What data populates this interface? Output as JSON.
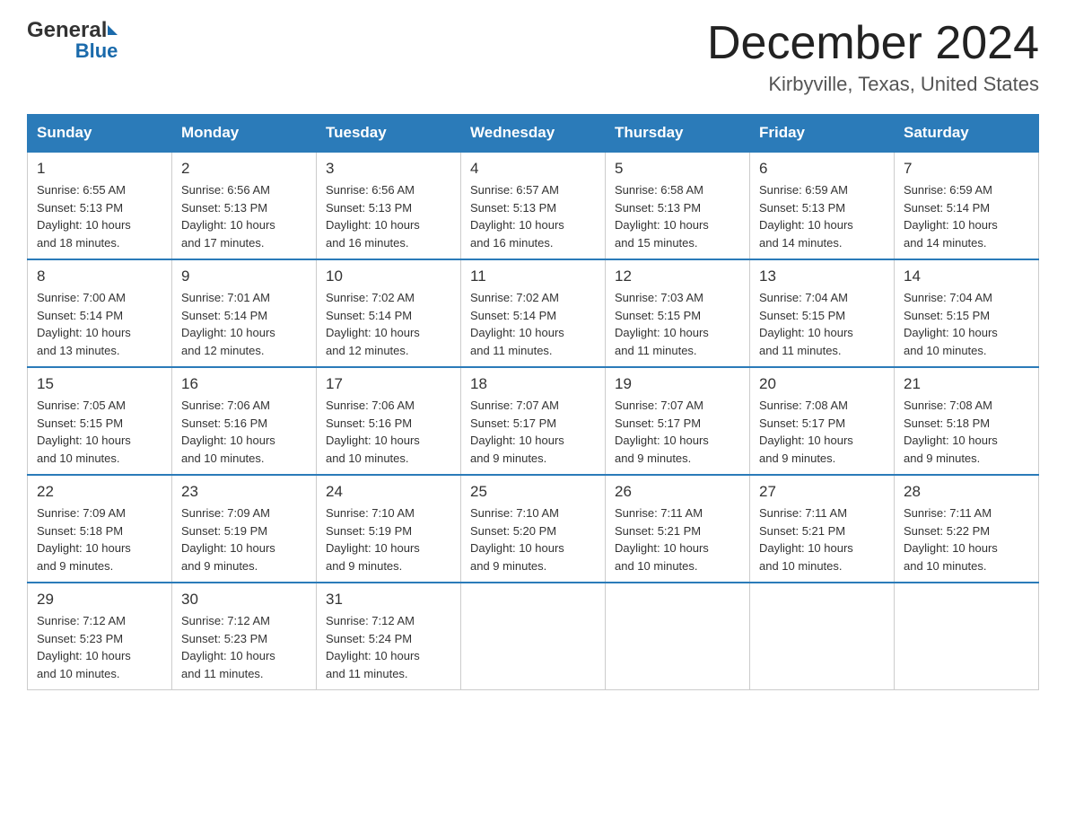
{
  "header": {
    "logo_general": "General",
    "logo_blue": "Blue",
    "month_title": "December 2024",
    "location": "Kirbyville, Texas, United States"
  },
  "days_of_week": [
    "Sunday",
    "Monday",
    "Tuesday",
    "Wednesday",
    "Thursday",
    "Friday",
    "Saturday"
  ],
  "weeks": [
    [
      {
        "day": "1",
        "sunrise": "6:55 AM",
        "sunset": "5:13 PM",
        "daylight": "10 hours and 18 minutes."
      },
      {
        "day": "2",
        "sunrise": "6:56 AM",
        "sunset": "5:13 PM",
        "daylight": "10 hours and 17 minutes."
      },
      {
        "day": "3",
        "sunrise": "6:56 AM",
        "sunset": "5:13 PM",
        "daylight": "10 hours and 16 minutes."
      },
      {
        "day": "4",
        "sunrise": "6:57 AM",
        "sunset": "5:13 PM",
        "daylight": "10 hours and 16 minutes."
      },
      {
        "day": "5",
        "sunrise": "6:58 AM",
        "sunset": "5:13 PM",
        "daylight": "10 hours and 15 minutes."
      },
      {
        "day": "6",
        "sunrise": "6:59 AM",
        "sunset": "5:13 PM",
        "daylight": "10 hours and 14 minutes."
      },
      {
        "day": "7",
        "sunrise": "6:59 AM",
        "sunset": "5:14 PM",
        "daylight": "10 hours and 14 minutes."
      }
    ],
    [
      {
        "day": "8",
        "sunrise": "7:00 AM",
        "sunset": "5:14 PM",
        "daylight": "10 hours and 13 minutes."
      },
      {
        "day": "9",
        "sunrise": "7:01 AM",
        "sunset": "5:14 PM",
        "daylight": "10 hours and 12 minutes."
      },
      {
        "day": "10",
        "sunrise": "7:02 AM",
        "sunset": "5:14 PM",
        "daylight": "10 hours and 12 minutes."
      },
      {
        "day": "11",
        "sunrise": "7:02 AM",
        "sunset": "5:14 PM",
        "daylight": "10 hours and 11 minutes."
      },
      {
        "day": "12",
        "sunrise": "7:03 AM",
        "sunset": "5:15 PM",
        "daylight": "10 hours and 11 minutes."
      },
      {
        "day": "13",
        "sunrise": "7:04 AM",
        "sunset": "5:15 PM",
        "daylight": "10 hours and 11 minutes."
      },
      {
        "day": "14",
        "sunrise": "7:04 AM",
        "sunset": "5:15 PM",
        "daylight": "10 hours and 10 minutes."
      }
    ],
    [
      {
        "day": "15",
        "sunrise": "7:05 AM",
        "sunset": "5:15 PM",
        "daylight": "10 hours and 10 minutes."
      },
      {
        "day": "16",
        "sunrise": "7:06 AM",
        "sunset": "5:16 PM",
        "daylight": "10 hours and 10 minutes."
      },
      {
        "day": "17",
        "sunrise": "7:06 AM",
        "sunset": "5:16 PM",
        "daylight": "10 hours and 10 minutes."
      },
      {
        "day": "18",
        "sunrise": "7:07 AM",
        "sunset": "5:17 PM",
        "daylight": "10 hours and 9 minutes."
      },
      {
        "day": "19",
        "sunrise": "7:07 AM",
        "sunset": "5:17 PM",
        "daylight": "10 hours and 9 minutes."
      },
      {
        "day": "20",
        "sunrise": "7:08 AM",
        "sunset": "5:17 PM",
        "daylight": "10 hours and 9 minutes."
      },
      {
        "day": "21",
        "sunrise": "7:08 AM",
        "sunset": "5:18 PM",
        "daylight": "10 hours and 9 minutes."
      }
    ],
    [
      {
        "day": "22",
        "sunrise": "7:09 AM",
        "sunset": "5:18 PM",
        "daylight": "10 hours and 9 minutes."
      },
      {
        "day": "23",
        "sunrise": "7:09 AM",
        "sunset": "5:19 PM",
        "daylight": "10 hours and 9 minutes."
      },
      {
        "day": "24",
        "sunrise": "7:10 AM",
        "sunset": "5:19 PM",
        "daylight": "10 hours and 9 minutes."
      },
      {
        "day": "25",
        "sunrise": "7:10 AM",
        "sunset": "5:20 PM",
        "daylight": "10 hours and 9 minutes."
      },
      {
        "day": "26",
        "sunrise": "7:11 AM",
        "sunset": "5:21 PM",
        "daylight": "10 hours and 10 minutes."
      },
      {
        "day": "27",
        "sunrise": "7:11 AM",
        "sunset": "5:21 PM",
        "daylight": "10 hours and 10 minutes."
      },
      {
        "day": "28",
        "sunrise": "7:11 AM",
        "sunset": "5:22 PM",
        "daylight": "10 hours and 10 minutes."
      }
    ],
    [
      {
        "day": "29",
        "sunrise": "7:12 AM",
        "sunset": "5:23 PM",
        "daylight": "10 hours and 10 minutes."
      },
      {
        "day": "30",
        "sunrise": "7:12 AM",
        "sunset": "5:23 PM",
        "daylight": "10 hours and 11 minutes."
      },
      {
        "day": "31",
        "sunrise": "7:12 AM",
        "sunset": "5:24 PM",
        "daylight": "10 hours and 11 minutes."
      },
      null,
      null,
      null,
      null
    ]
  ],
  "labels": {
    "sunrise": "Sunrise:",
    "sunset": "Sunset:",
    "daylight": "Daylight:"
  }
}
